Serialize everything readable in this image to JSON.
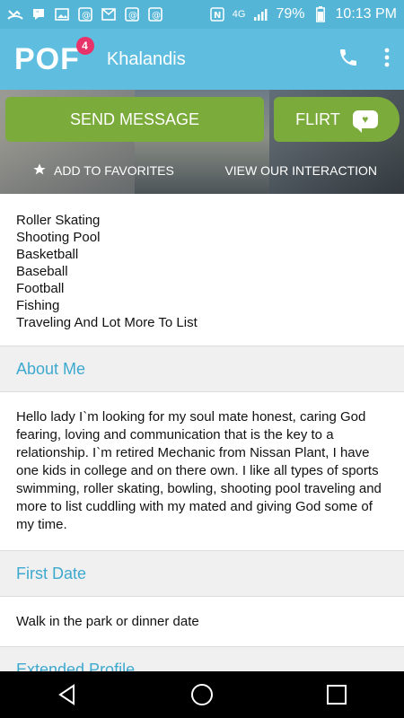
{
  "status_bar": {
    "battery": "79%",
    "time": "10:13 PM",
    "network": "4G"
  },
  "header": {
    "logo": "POF",
    "badge_count": "4",
    "username": "Khalandis"
  },
  "actions": {
    "send_message": "SEND MESSAGE",
    "flirt": "FLIRT",
    "add_to_favorites": "ADD TO FAVORITES",
    "view_interaction": "VIEW OUR INTERACTION"
  },
  "interests": [
    "Roller Skating",
    "Shooting Pool",
    "Basketball",
    "Baseball",
    "Football",
    "Fishing",
    "Traveling And Lot More To List"
  ],
  "sections": {
    "about_me_title": "About Me",
    "about_me_text": "Hello lady I`m looking for my soul mate honest, caring God fearing, loving and communication that is the key to a relationship. I`m retired Mechanic from Nissan Plant, I have one kids in college and on there own. I like all types of sports swimming, roller skating, bowling, shooting pool traveling and more to list cuddling with my mated and giving God some of my time.",
    "first_date_title": "First Date",
    "first_date_text": "Walk in the park or dinner date",
    "extended_profile_title": "Extended Profile"
  }
}
